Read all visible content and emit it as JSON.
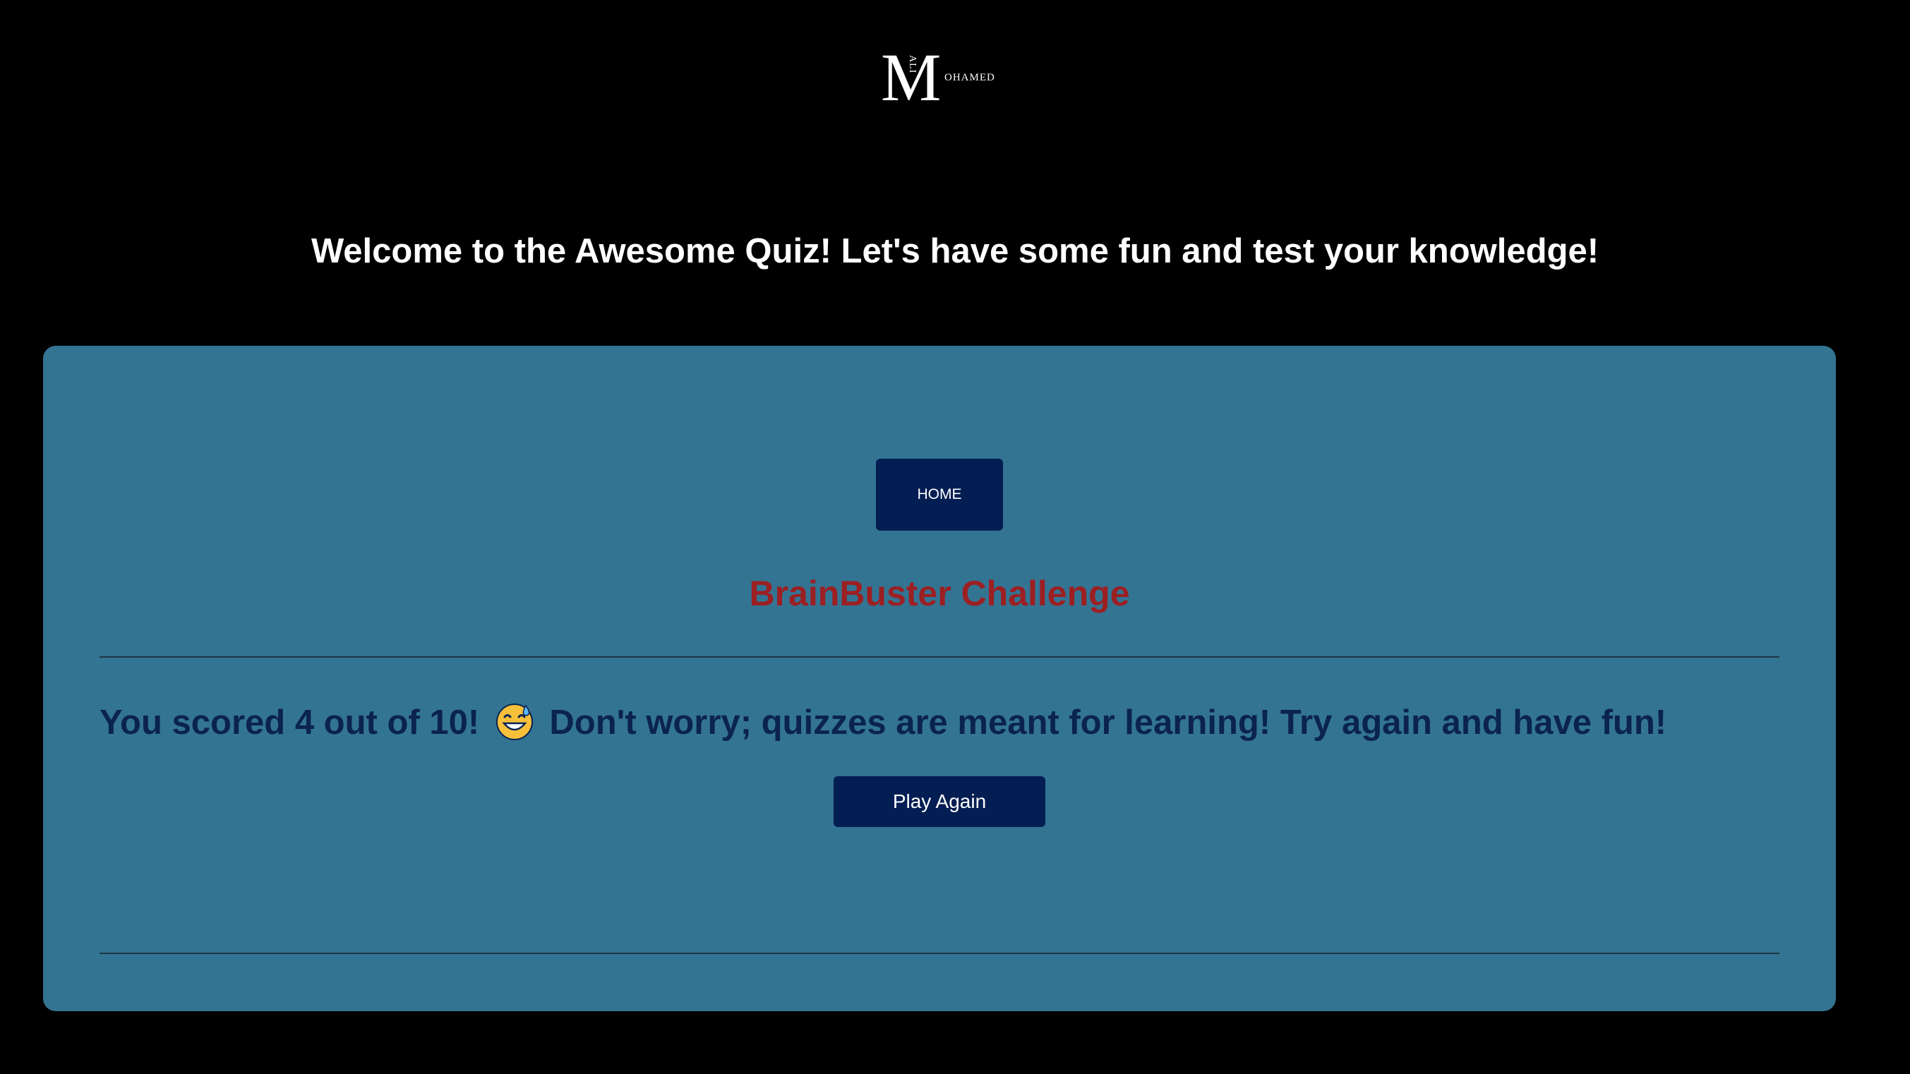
{
  "logo": {
    "initial": "M",
    "vertical_text": "ALI",
    "side_text": "OHAMED"
  },
  "welcome_text": "Welcome to the Awesome Quiz! Let's have some fun and test your knowledge!",
  "card": {
    "home_label": "HOME",
    "title": "BrainBuster Challenge",
    "result_before": "You scored 4 out of 10!",
    "emoji_icon": "grinning-sweat-emoji",
    "result_after": "Don't worry; quizzes are meant for learning! Try again and have fun!",
    "play_again_label": "Play Again"
  },
  "colors": {
    "background": "#000000",
    "card": "#337493",
    "button": "#031e52",
    "title": "#9c1f22",
    "result_text": "#0b2350"
  }
}
